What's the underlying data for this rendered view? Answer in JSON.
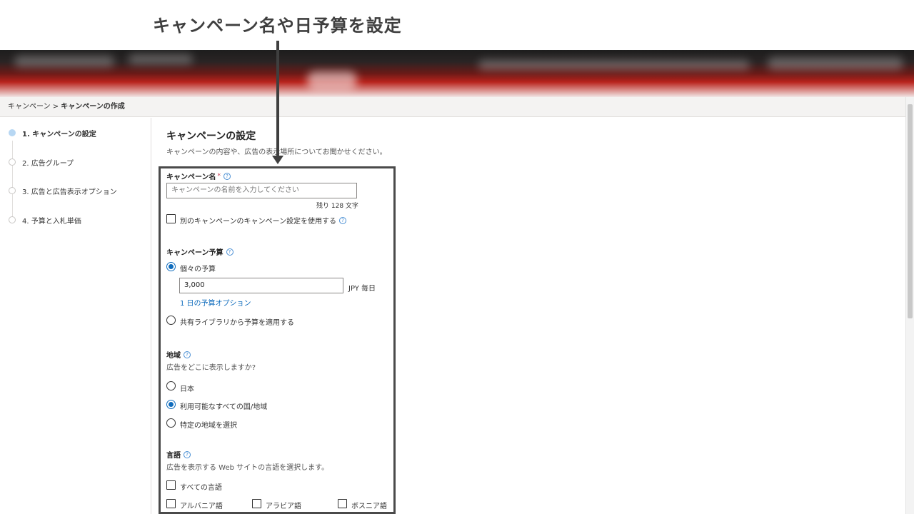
{
  "annotation": {
    "title": "キャンペーン名や日予算を設定"
  },
  "breadcrumb": {
    "parent": "キャンペーン",
    "separator": ">",
    "current": "キャンペーンの作成"
  },
  "steps": [
    {
      "label": "1. キャンペーンの設定",
      "active": true
    },
    {
      "label": "2. 広告グループ",
      "active": false
    },
    {
      "label": "3. 広告と広告表示オプション",
      "active": false
    },
    {
      "label": "4. 予算と入札単価",
      "active": false
    }
  ],
  "section": {
    "title": "キャンペーンの設定",
    "subtitle": "キャンペーンの内容や、広告の表示場所についてお聞かせください。"
  },
  "campaign_name": {
    "label": "キャンペーン名",
    "required_mark": "*",
    "placeholder": "キャンペーンの名前を入力してください",
    "remaining": "残り 128 文字",
    "use_other_label": "別のキャンペーンのキャンペーン設定を使用する"
  },
  "budget": {
    "label": "キャンペーン予算",
    "individual_label": "個々の予算",
    "amount": "3,000",
    "unit": "JPY 毎日",
    "options_link": "1 日の予算オプション",
    "shared_label": "共有ライブラリから予算を適用する"
  },
  "location": {
    "label": "地域",
    "question": "広告をどこに表示しますか?",
    "options": [
      "日本",
      "利用可能なすべての国/地域",
      "特定の地域を選択"
    ],
    "selected_index": 1
  },
  "language": {
    "label": "言語",
    "description": "広告を表示する Web サイトの言語を選択します。",
    "all_label": "すべての言語",
    "options": [
      "アルバニア語",
      "アラビア語",
      "ボスニア語"
    ]
  },
  "icons": {
    "help": "?"
  },
  "colors": {
    "accent": "#0f6cbd",
    "annotation": "#3f3f3f",
    "header_red": "#b8231c"
  }
}
